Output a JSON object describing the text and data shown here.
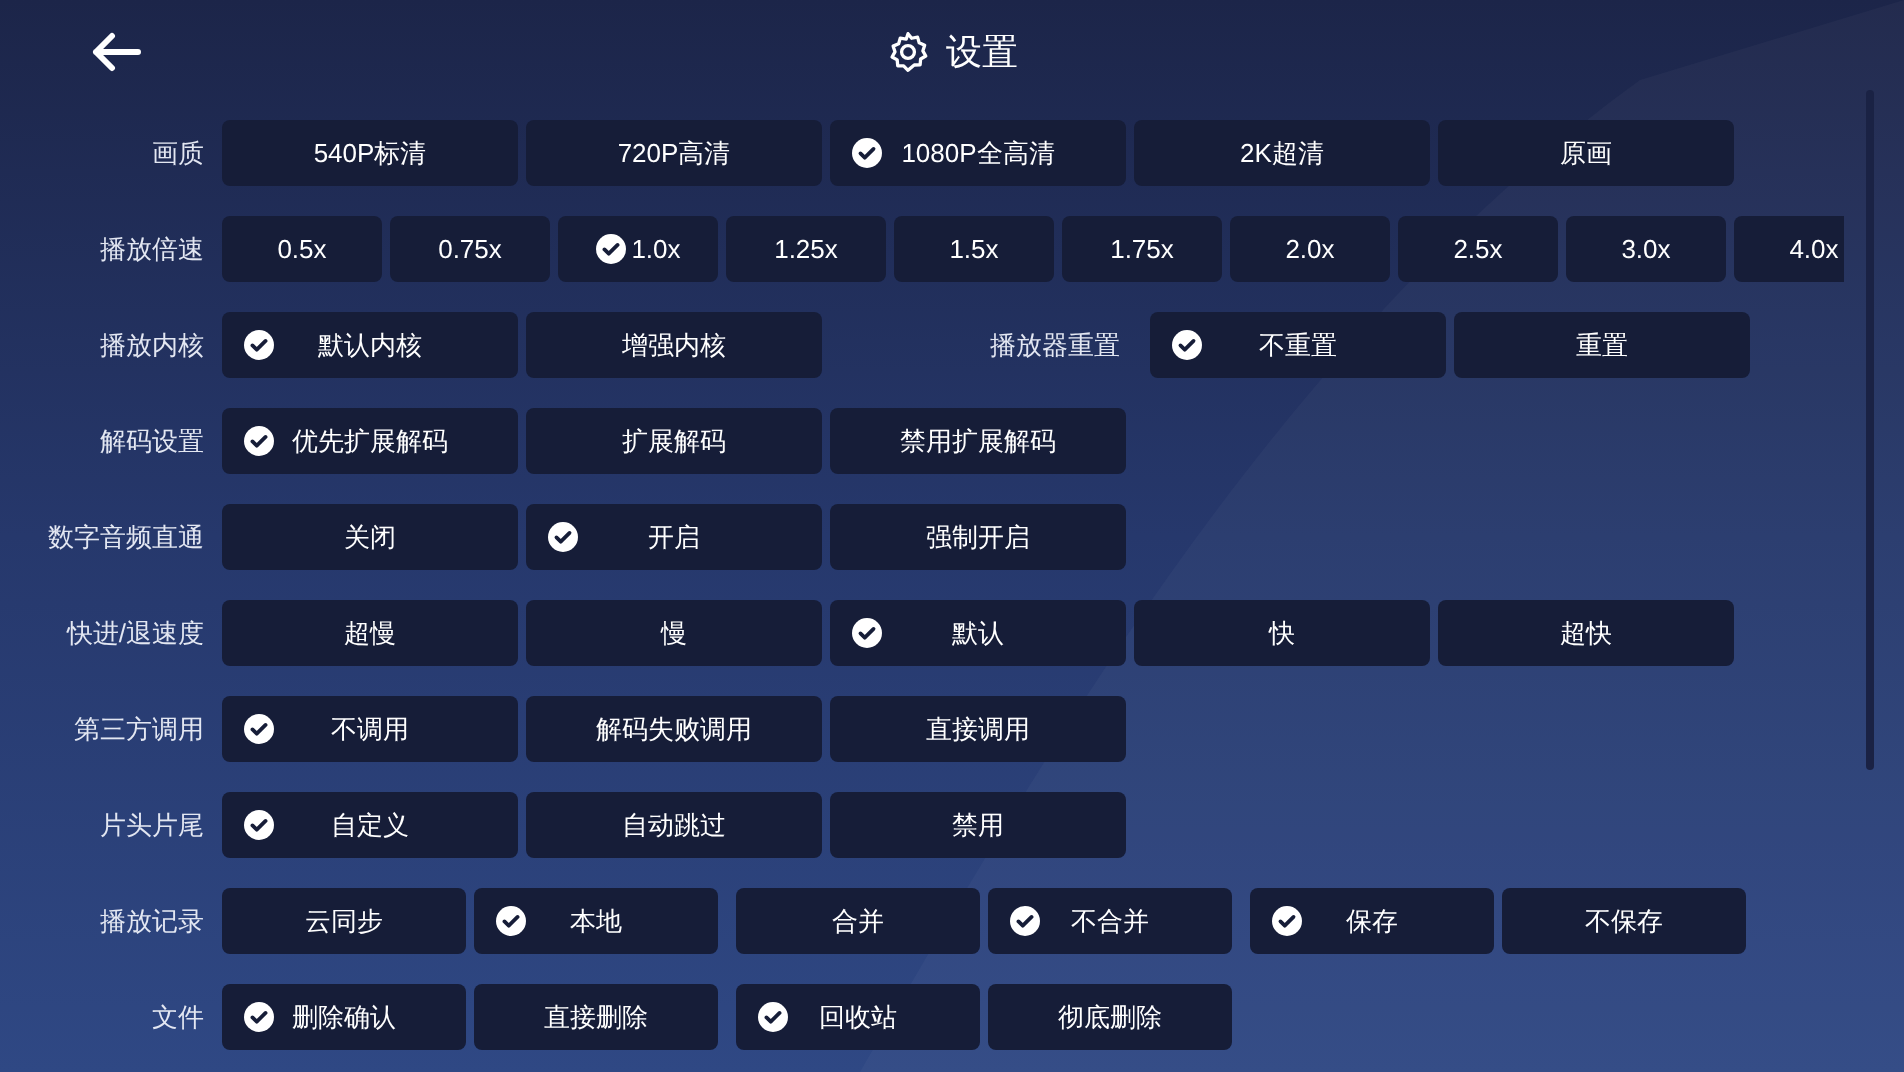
{
  "header": {
    "title": "设置"
  },
  "rows": [
    {
      "label": "画质",
      "kind": "wide",
      "groups": [
        {
          "options": [
            {
              "text": "540P标清",
              "selected": false
            },
            {
              "text": "720P高清",
              "selected": false
            },
            {
              "text": "1080P全高清",
              "selected": true
            },
            {
              "text": "2K超清",
              "selected": false
            },
            {
              "text": "原画",
              "selected": false
            }
          ]
        }
      ]
    },
    {
      "label": "播放倍速",
      "kind": "compact",
      "groups": [
        {
          "options": [
            {
              "text": "0.5x",
              "selected": false
            },
            {
              "text": "0.75x",
              "selected": false
            },
            {
              "text": "1.0x",
              "selected": true
            },
            {
              "text": "1.25x",
              "selected": false
            },
            {
              "text": "1.5x",
              "selected": false
            },
            {
              "text": "1.75x",
              "selected": false
            },
            {
              "text": "2.0x",
              "selected": false
            },
            {
              "text": "2.5x",
              "selected": false
            },
            {
              "text": "3.0x",
              "selected": false
            },
            {
              "text": "4.0x",
              "selected": false
            }
          ]
        }
      ]
    },
    {
      "label": "播放内核",
      "kind": "wide",
      "groups": [
        {
          "options": [
            {
              "text": "默认内核",
              "selected": true
            },
            {
              "text": "增强内核",
              "selected": false
            }
          ]
        },
        {
          "label": "播放器重置",
          "options": [
            {
              "text": "不重置",
              "selected": true
            },
            {
              "text": "重置",
              "selected": false
            }
          ]
        }
      ]
    },
    {
      "label": "解码设置",
      "kind": "wide",
      "groups": [
        {
          "options": [
            {
              "text": "优先扩展解码",
              "selected": true
            },
            {
              "text": "扩展解码",
              "selected": false
            },
            {
              "text": "禁用扩展解码",
              "selected": false
            }
          ]
        }
      ]
    },
    {
      "label": "数字音频直通",
      "kind": "wide",
      "groups": [
        {
          "options": [
            {
              "text": "关闭",
              "selected": false
            },
            {
              "text": "开启",
              "selected": true
            },
            {
              "text": "强制开启",
              "selected": false
            }
          ]
        }
      ]
    },
    {
      "label": "快进/退速度",
      "kind": "wide",
      "groups": [
        {
          "options": [
            {
              "text": "超慢",
              "selected": false
            },
            {
              "text": "慢",
              "selected": false
            },
            {
              "text": "默认",
              "selected": true
            },
            {
              "text": "快",
              "selected": false
            },
            {
              "text": "超快",
              "selected": false
            }
          ]
        }
      ]
    },
    {
      "label": "第三方调用",
      "kind": "wide",
      "groups": [
        {
          "options": [
            {
              "text": "不调用",
              "selected": true
            },
            {
              "text": "解码失败调用",
              "selected": false
            },
            {
              "text": "直接调用",
              "selected": false
            }
          ]
        }
      ]
    },
    {
      "label": "片头片尾",
      "kind": "wide",
      "groups": [
        {
          "options": [
            {
              "text": "自定义",
              "selected": true
            },
            {
              "text": "自动跳过",
              "selected": false
            },
            {
              "text": "禁用",
              "selected": false
            }
          ]
        }
      ]
    },
    {
      "label": "播放记录",
      "kind": "medium",
      "groups": [
        {
          "options": [
            {
              "text": "云同步",
              "selected": false
            },
            {
              "text": "本地",
              "selected": true
            }
          ]
        },
        {
          "options": [
            {
              "text": "合并",
              "selected": false
            },
            {
              "text": "不合并",
              "selected": true
            }
          ]
        },
        {
          "options": [
            {
              "text": "保存",
              "selected": true
            },
            {
              "text": "不保存",
              "selected": false
            }
          ]
        }
      ]
    },
    {
      "label": "文件",
      "kind": "medium",
      "groups": [
        {
          "options": [
            {
              "text": "删除确认",
              "selected": true
            },
            {
              "text": "直接删除",
              "selected": false
            }
          ]
        },
        {
          "options": [
            {
              "text": "回收站",
              "selected": true
            },
            {
              "text": "彻底删除",
              "selected": false
            }
          ]
        }
      ]
    }
  ]
}
